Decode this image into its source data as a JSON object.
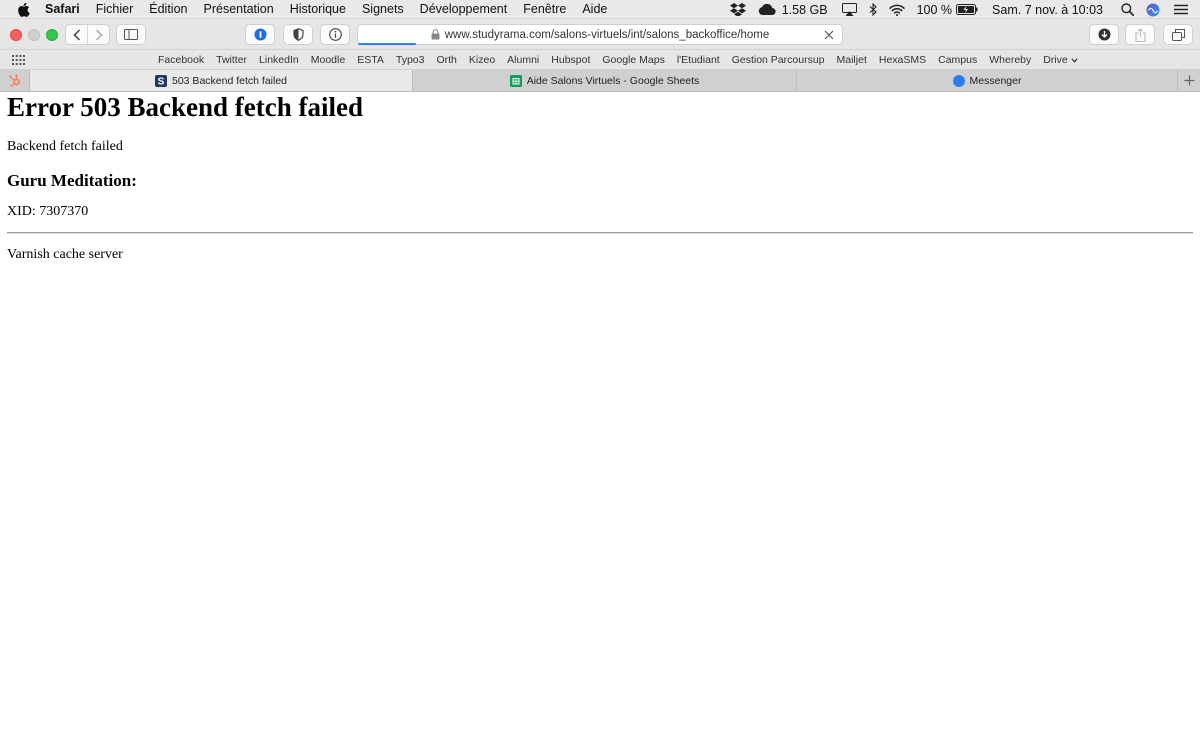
{
  "menubar": {
    "app_name": "Safari",
    "items": [
      "Fichier",
      "Édition",
      "Présentation",
      "Historique",
      "Signets",
      "Développement",
      "Fenêtre",
      "Aide"
    ],
    "memory": "1.58 GB",
    "battery": "100 %",
    "datetime": "Sam. 7 nov. à  10:03"
  },
  "toolbar": {
    "url": "www.studyrama.com/salons-virtuels/int/salons_backoffice/home",
    "load_progress": 0.12
  },
  "favorites": {
    "items": [
      "Facebook",
      "Twitter",
      "LinkedIn",
      "Moodle",
      "ESTA",
      "Typo3",
      "Orth",
      "Kizeo",
      "Alumni",
      "Hubspot",
      "Google Maps",
      "l'Etudiant",
      "Gestion Parcoursup",
      "Mailjet",
      "HexaSMS",
      "Campus",
      "Whereby"
    ],
    "drive_label": "Drive"
  },
  "tabs": [
    {
      "title": "503 Backend fetch failed",
      "icon": "studyrama-s-icon",
      "active": true
    },
    {
      "title": "Aide Salons Virtuels - Google Sheets",
      "icon": "google-sheets-icon",
      "active": false
    },
    {
      "title": "Messenger",
      "icon": "messenger-icon",
      "active": false
    }
  ],
  "page": {
    "heading": "Error 503 Backend fetch failed",
    "message": "Backend fetch failed",
    "subheading": "Guru Meditation:",
    "xid": "XID: 7307370",
    "footer": "Varnish cache server"
  },
  "colors": {
    "close": "#fc605b",
    "minimize": "#cfcfcf",
    "zoom": "#34c84a",
    "accent": "#2f7cf6",
    "sheets_green": "#0f9d58",
    "hubspot_orange": "#ff7a59"
  }
}
